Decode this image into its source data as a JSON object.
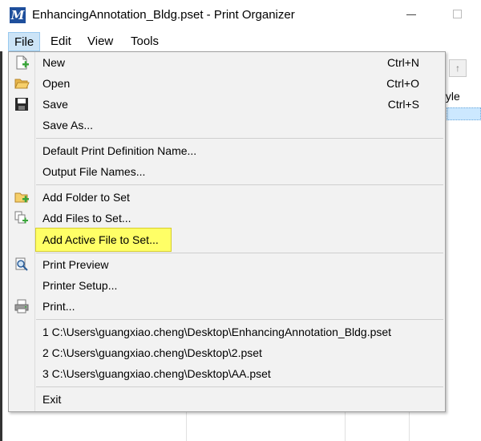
{
  "window": {
    "title": "EnhancingAnnotation_Bldg.pset - Print Organizer",
    "app_icon_glyph": "M",
    "app_icon": "microstation-logo-icon",
    "accent_color": "#1e4f9c"
  },
  "menubar": {
    "items": [
      "File",
      "Edit",
      "View",
      "Tools"
    ],
    "active": "File"
  },
  "background": {
    "column_header": "tyle",
    "toolbar_icon": "up-arrow-icon"
  },
  "file_menu": {
    "items": [
      {
        "label": "New",
        "shortcut": "Ctrl+N",
        "icon": "new-file-icon"
      },
      {
        "label": "Open",
        "shortcut": "Ctrl+O",
        "icon": "open-folder-icon"
      },
      {
        "label": "Save",
        "shortcut": "Ctrl+S",
        "icon": "save-disk-icon"
      },
      {
        "label": "Save As...",
        "shortcut": ""
      },
      {
        "label": "Default Print Definition Name...",
        "shortcut": ""
      },
      {
        "label": "Output File Names...",
        "shortcut": ""
      },
      {
        "label": "Add Folder to Set",
        "shortcut": "",
        "icon": "add-folder-icon"
      },
      {
        "label": "Add Files to Set...",
        "shortcut": "",
        "icon": "add-files-icon"
      },
      {
        "label": "Add Active File to Set...",
        "shortcut": "",
        "highlighted": true
      },
      {
        "label": "Print Preview",
        "shortcut": "",
        "icon": "print-preview-icon"
      },
      {
        "label": "Printer Setup...",
        "shortcut": ""
      },
      {
        "label": "Print...",
        "shortcut": "",
        "icon": "printer-icon"
      },
      {
        "label": "1 C:\\Users\\guangxiao.cheng\\Desktop\\EnhancingAnnotation_Bldg.pset",
        "shortcut": ""
      },
      {
        "label": "2 C:\\Users\\guangxiao.cheng\\Desktop\\2.pset",
        "shortcut": ""
      },
      {
        "label": "3 C:\\Users\\guangxiao.cheng\\Desktop\\AA.pset",
        "shortcut": ""
      },
      {
        "label": "Exit",
        "shortcut": ""
      }
    ],
    "highlight_color": "#ffff66"
  }
}
